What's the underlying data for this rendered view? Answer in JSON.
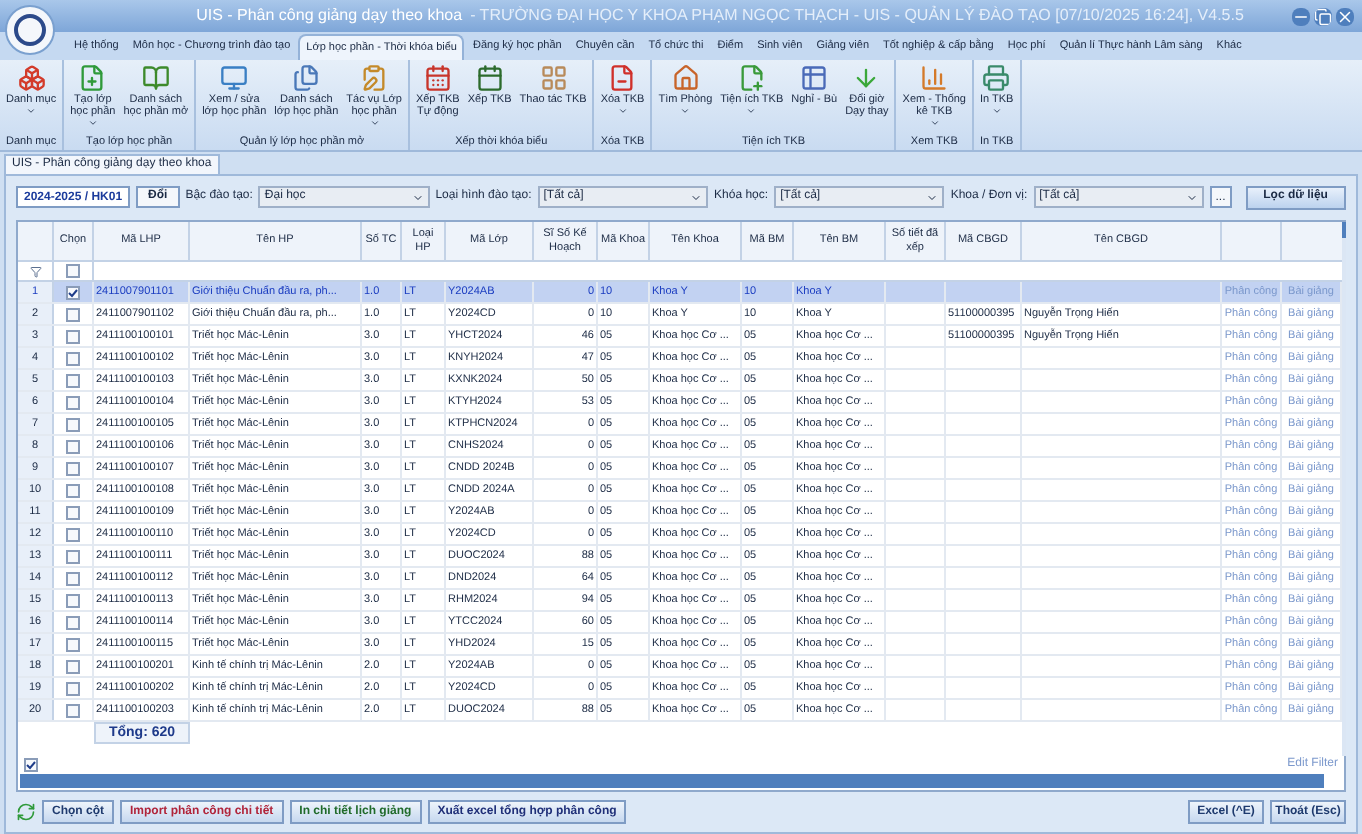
{
  "window": {
    "title": "UIS - Phân công giảng dạy theo khoa",
    "subtitle": "- TRƯỜNG ĐẠI HỌC Y KHOA PHẠM NGỌC THẠCH - UIS - QUẢN LÝ ĐÀO TẠO [07/10/2025 16:24], V4.5.5"
  },
  "menu": [
    {
      "label": "Hệ thống",
      "selected": false
    },
    {
      "label": "Môn học - Chương trình đào tạo",
      "selected": false
    },
    {
      "label": "Lớp học phần - Thời khóa biểu",
      "selected": true
    },
    {
      "label": "Đăng ký học phần",
      "selected": false
    },
    {
      "label": "Chuyên cần",
      "selected": false
    },
    {
      "label": "Tổ chức thi",
      "selected": false
    },
    {
      "label": "Điểm",
      "selected": false
    },
    {
      "label": "Sinh viên",
      "selected": false
    },
    {
      "label": "Giảng viên",
      "selected": false
    },
    {
      "label": "Tốt nghiệp & cấp bằng",
      "selected": false
    },
    {
      "label": "Học phí",
      "selected": false
    },
    {
      "label": "Quản lí Thực hành Lâm sàng",
      "selected": false
    },
    {
      "label": "Khác",
      "selected": false
    }
  ],
  "ribbon": [
    {
      "label": "Danh mục",
      "buttons": [
        {
          "label": "Danh mục",
          "dropdown": true
        }
      ]
    },
    {
      "label": "Tạo lớp học phần",
      "buttons": [
        {
          "label": "Tạo lớp\nhọc phần",
          "dropdown": true
        },
        {
          "label": "Danh sách\nhọc phần mở",
          "dropdown": false
        }
      ]
    },
    {
      "label": "Quản lý lớp học phần mở",
      "buttons": [
        {
          "label": "Xem / sửa\nlớp học phần",
          "dropdown": false
        },
        {
          "label": "Danh sách\nlớp học phần",
          "dropdown": false
        },
        {
          "label": "Tác vụ Lớp\nhọc phần",
          "dropdown": true
        }
      ]
    },
    {
      "label": "Xếp thời khóa biểu",
      "buttons": [
        {
          "label": "Xếp TKB\nTự động",
          "dropdown": false
        },
        {
          "label": "Xếp TKB",
          "dropdown": false
        },
        {
          "label": "Thao tác TKB",
          "dropdown": false
        }
      ]
    },
    {
      "label": "Xóa TKB",
      "buttons": [
        {
          "label": "Xóa TKB",
          "dropdown": true
        }
      ]
    },
    {
      "label": "Tiện ích TKB",
      "buttons": [
        {
          "label": "Tìm Phòng",
          "dropdown": true
        },
        {
          "label": "Tiện ích TKB",
          "dropdown": true
        },
        {
          "label": "Nghỉ - Bù",
          "dropdown": false
        },
        {
          "label": "Đổi giờ\nDạy thay",
          "dropdown": false
        }
      ]
    },
    {
      "label": "Xem TKB",
      "buttons": [
        {
          "label": "Xem - Thống\nkê TKB",
          "dropdown": true
        }
      ]
    },
    {
      "label": "In TKB",
      "buttons": [
        {
          "label": "In TKB",
          "dropdown": true
        }
      ]
    }
  ],
  "document_tab": "UIS - Phân công giảng dạy theo khoa",
  "filters": {
    "term": "2024-2025 / HK01",
    "change_button": "Đổi",
    "fields": [
      {
        "label": "Bậc đào tạo:",
        "value": "Đại học"
      },
      {
        "label": "Loại hình đào tạo:",
        "value": "[Tất cả]"
      },
      {
        "label": "Khóa học:",
        "value": "[Tất cả]"
      },
      {
        "label": "Khoa / Đơn vị:",
        "value": "[Tất cả]"
      }
    ],
    "browse_button": "...",
    "filter_button": "Lọc dữ liệu"
  },
  "table": {
    "check_column": "Chọn",
    "columns": [
      "Mã LHP",
      "Tên HP",
      "Số TC",
      "Loại HP",
      "Mã Lớp",
      "Sĩ Số Kế Hoạch",
      "Mã Khoa",
      "Tên Khoa",
      "Mã BM",
      "Tên BM",
      "Số tiết đã xếp",
      "Mã CBGD",
      "Tên CBGD"
    ],
    "filter_row": {
      "checked": false
    },
    "rows": [
      {
        "number": "1",
        "selected": true,
        "checked": true,
        "cells": [
          "2411007901101",
          "Giới thiệu Chuẩn đầu ra, ph...",
          "1.0",
          "LT",
          "Y2024AB",
          "0",
          "10",
          "Khoa Y",
          "10",
          "Khoa Y",
          null,
          null,
          null
        ],
        "actions": [
          "Phân công",
          "Bài giảng"
        ]
      },
      {
        "number": "2",
        "selected": false,
        "checked": false,
        "cells": [
          "2411007901102",
          "Giới thiệu Chuẩn đầu ra, ph...",
          "1.0",
          "LT",
          "Y2024CD",
          "0",
          "10",
          "Khoa Y",
          "10",
          "Khoa Y",
          null,
          "51100000395",
          "Nguyễn Trọng Hiến"
        ],
        "actions": [
          "Phân công",
          "Bài giảng"
        ]
      },
      {
        "number": "3",
        "selected": false,
        "checked": false,
        "cells": [
          "2411100100101",
          "Triết học Mác-Lênin",
          "3.0",
          "LT",
          "YHCT2024",
          "46",
          "05",
          "Khoa học Cơ ...",
          "05",
          "Khoa học Cơ ...",
          null,
          "51100000395",
          "Nguyễn Trọng Hiến"
        ],
        "actions": [
          "Phân công",
          "Bài giảng"
        ]
      },
      {
        "number": "4",
        "selected": false,
        "checked": false,
        "cells": [
          "2411100100102",
          "Triết học Mác-Lênin",
          "3.0",
          "LT",
          "KNYH2024",
          "47",
          "05",
          "Khoa học Cơ ...",
          "05",
          "Khoa học Cơ ...",
          null,
          null,
          null
        ],
        "actions": [
          "Phân công",
          "Bài giảng"
        ]
      },
      {
        "number": "5",
        "selected": false,
        "checked": false,
        "cells": [
          "2411100100103",
          "Triết học Mác-Lênin",
          "3.0",
          "LT",
          "KXNK2024",
          "50",
          "05",
          "Khoa học Cơ ...",
          "05",
          "Khoa học Cơ ...",
          null,
          null,
          null
        ],
        "actions": [
          "Phân công",
          "Bài giảng"
        ]
      },
      {
        "number": "6",
        "selected": false,
        "checked": false,
        "cells": [
          "2411100100104",
          "Triết học Mác-Lênin",
          "3.0",
          "LT",
          "KTYH2024",
          "53",
          "05",
          "Khoa học Cơ ...",
          "05",
          "Khoa học Cơ ...",
          null,
          null,
          null
        ],
        "actions": [
          "Phân công",
          "Bài giảng"
        ]
      },
      {
        "number": "7",
        "selected": false,
        "checked": false,
        "cells": [
          "2411100100105",
          "Triết học Mác-Lênin",
          "3.0",
          "LT",
          "KTPHCN2024",
          "0",
          "05",
          "Khoa học Cơ ...",
          "05",
          "Khoa học Cơ ...",
          null,
          null,
          null
        ],
        "actions": [
          "Phân công",
          "Bài giảng"
        ]
      },
      {
        "number": "8",
        "selected": false,
        "checked": false,
        "cells": [
          "2411100100106",
          "Triết học Mác-Lênin",
          "3.0",
          "LT",
          "CNHS2024",
          "0",
          "05",
          "Khoa học Cơ ...",
          "05",
          "Khoa học Cơ ...",
          null,
          null,
          null
        ],
        "actions": [
          "Phân công",
          "Bài giảng"
        ]
      },
      {
        "number": "9",
        "selected": false,
        "checked": false,
        "cells": [
          "2411100100107",
          "Triết học Mác-Lênin",
          "3.0",
          "LT",
          "CNDD 2024B",
          "0",
          "05",
          "Khoa học Cơ ...",
          "05",
          "Khoa học Cơ ...",
          null,
          null,
          null
        ],
        "actions": [
          "Phân công",
          "Bài giảng"
        ]
      },
      {
        "number": "10",
        "selected": false,
        "checked": false,
        "cells": [
          "2411100100108",
          "Triết học Mác-Lênin",
          "3.0",
          "LT",
          "CNDD 2024A",
          "0",
          "05",
          "Khoa học Cơ ...",
          "05",
          "Khoa học Cơ ...",
          null,
          null,
          null
        ],
        "actions": [
          "Phân công",
          "Bài giảng"
        ]
      },
      {
        "number": "11",
        "selected": false,
        "checked": false,
        "cells": [
          "2411100100109",
          "Triết học Mác-Lênin",
          "3.0",
          "LT",
          "Y2024AB",
          "0",
          "05",
          "Khoa học Cơ ...",
          "05",
          "Khoa học Cơ ...",
          null,
          null,
          null
        ],
        "actions": [
          "Phân công",
          "Bài giảng"
        ]
      },
      {
        "number": "12",
        "selected": false,
        "checked": false,
        "cells": [
          "2411100100110",
          "Triết học Mác-Lênin",
          "3.0",
          "LT",
          "Y2024CD",
          "0",
          "05",
          "Khoa học Cơ ...",
          "05",
          "Khoa học Cơ ...",
          null,
          null,
          null
        ],
        "actions": [
          "Phân công",
          "Bài giảng"
        ]
      },
      {
        "number": "13",
        "selected": false,
        "checked": false,
        "cells": [
          "2411100100111",
          "Triết học Mác-Lênin",
          "3.0",
          "LT",
          "DUOC2024",
          "88",
          "05",
          "Khoa học Cơ ...",
          "05",
          "Khoa học Cơ ...",
          null,
          null,
          null
        ],
        "actions": [
          "Phân công",
          "Bài giảng"
        ]
      },
      {
        "number": "14",
        "selected": false,
        "checked": false,
        "cells": [
          "2411100100112",
          "Triết học Mác-Lênin",
          "3.0",
          "LT",
          "DND2024",
          "64",
          "05",
          "Khoa học Cơ ...",
          "05",
          "Khoa học Cơ ...",
          null,
          null,
          null
        ],
        "actions": [
          "Phân công",
          "Bài giảng"
        ]
      },
      {
        "number": "15",
        "selected": false,
        "checked": false,
        "cells": [
          "2411100100113",
          "Triết học Mác-Lênin",
          "3.0",
          "LT",
          "RHM2024",
          "94",
          "05",
          "Khoa học Cơ ...",
          "05",
          "Khoa học Cơ ...",
          null,
          null,
          null
        ],
        "actions": [
          "Phân công",
          "Bài giảng"
        ]
      },
      {
        "number": "16",
        "selected": false,
        "checked": false,
        "cells": [
          "2411100100114",
          "Triết học Mác-Lênin",
          "3.0",
          "LT",
          "YTCC2024",
          "60",
          "05",
          "Khoa học Cơ ...",
          "05",
          "Khoa học Cơ ...",
          null,
          null,
          null
        ],
        "actions": [
          "Phân công",
          "Bài giảng"
        ]
      },
      {
        "number": "17",
        "selected": false,
        "checked": false,
        "cells": [
          "2411100100115",
          "Triết học Mác-Lênin",
          "3.0",
          "LT",
          "YHD2024",
          "15",
          "05",
          "Khoa học Cơ ...",
          "05",
          "Khoa học Cơ ...",
          null,
          null,
          null
        ],
        "actions": [
          "Phân công",
          "Bài giảng"
        ]
      },
      {
        "number": "18",
        "selected": false,
        "checked": false,
        "cells": [
          "2411100100201",
          "Kinh tế chính trị Mác-Lênin",
          "2.0",
          "LT",
          "Y2024AB",
          "0",
          "05",
          "Khoa học Cơ ...",
          "05",
          "Khoa học Cơ ...",
          null,
          null,
          null
        ],
        "actions": [
          "Phân công",
          "Bài giảng"
        ]
      },
      {
        "number": "19",
        "selected": false,
        "checked": false,
        "cells": [
          "2411100100202",
          "Kinh tế chính trị Mác-Lênin",
          "2.0",
          "LT",
          "Y2024CD",
          "0",
          "05",
          "Khoa học Cơ ...",
          "05",
          "Khoa học Cơ ...",
          null,
          null,
          null
        ],
        "actions": [
          "Phân công",
          "Bài giảng"
        ]
      },
      {
        "number": "20",
        "selected": false,
        "checked": false,
        "cells": [
          "2411100100203",
          "Kinh tế chính trị Mác-Lênin",
          "2.0",
          "LT",
          "DUOC2024",
          "88",
          "05",
          "Khoa học Cơ ...",
          "05",
          "Khoa học Cơ ...",
          null,
          null,
          null
        ],
        "actions": [
          "Phân công",
          "Bài giảng"
        ]
      }
    ],
    "total": "Tổng: 620",
    "filter_enabled": true,
    "edit_filter": "Edit Filter"
  },
  "buttons": [
    {
      "label": "Chọn cột",
      "color": "#1e3a6e"
    },
    {
      "label": "Import phân công chi tiết",
      "color": "#b0243a"
    },
    {
      "label": "In chi tiết lịch giảng",
      "color": "#1f6a2a"
    },
    {
      "label": "Xuất excel tổng hợp phân công",
      "color": "#1f2f78"
    }
  ],
  "right_buttons": [
    "Excel (^E)",
    "Thoát (Esc)"
  ]
}
